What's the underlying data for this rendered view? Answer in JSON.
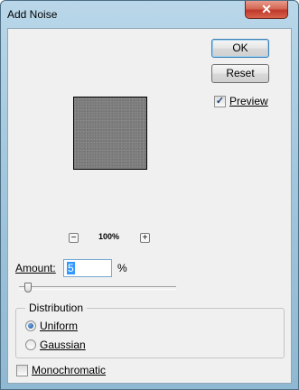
{
  "window": {
    "title": "Add Noise",
    "close_glyph": "✕"
  },
  "buttons": {
    "ok": "OK",
    "reset": "Reset"
  },
  "preview_checkbox": {
    "label": "Preview",
    "checked": true,
    "check_glyph": "✓"
  },
  "zoom": {
    "minus": "−",
    "plus": "+",
    "level": "100%"
  },
  "amount": {
    "label": "Amount:",
    "value": "5",
    "unit": "%",
    "slider_percent": 1.25
  },
  "distribution": {
    "legend": "Distribution",
    "options": [
      {
        "label": "Uniform",
        "selected": true
      },
      {
        "label": "Gaussian",
        "selected": false
      }
    ]
  },
  "monochromatic": {
    "label": "Monochromatic",
    "checked": false
  }
}
